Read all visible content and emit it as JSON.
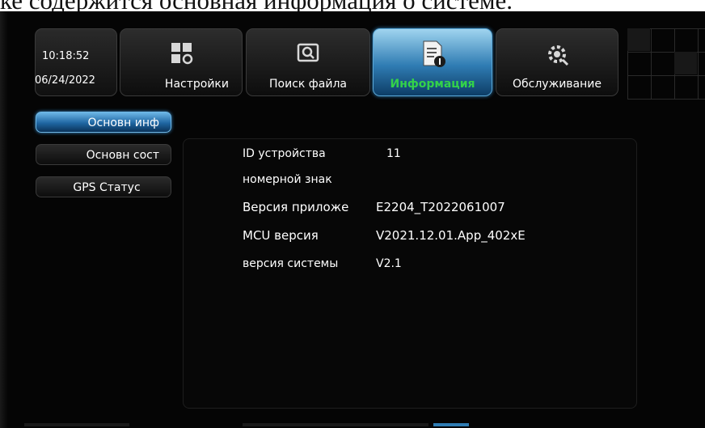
{
  "caption": "ке содержится основная информация о системе.",
  "clock": {
    "time": "10:18:52",
    "date": "06/24/2022"
  },
  "tabs": [
    {
      "label": "Настройки",
      "icon": "settings-grid-icon",
      "active": false
    },
    {
      "label": "Поиск файла",
      "icon": "file-search-icon",
      "active": false
    },
    {
      "label": "Информация",
      "icon": "document-info-icon",
      "active": true
    },
    {
      "label": "Обслуживание",
      "icon": "maintenance-gear-icon",
      "active": false
    }
  ],
  "side_menu": [
    {
      "label": "Основн инф",
      "active": true
    },
    {
      "label": "Основн сост",
      "active": false
    },
    {
      "label": "GPS Статус",
      "active": false
    }
  ],
  "info": [
    {
      "label": "ID устройства",
      "value": "11"
    },
    {
      "label": "номерной знак",
      "value": ""
    },
    {
      "label": "Версия приложе",
      "value": "E2204_T2022061007"
    },
    {
      "label": "MCU версия",
      "value": "V2021.12.01.App_402xE"
    },
    {
      "label": "версия системы",
      "value": "V2.1"
    }
  ],
  "colors": {
    "active_tab_label": "#33d24a",
    "active_blue": "#2f7cb3",
    "screen_background": "#050505"
  }
}
